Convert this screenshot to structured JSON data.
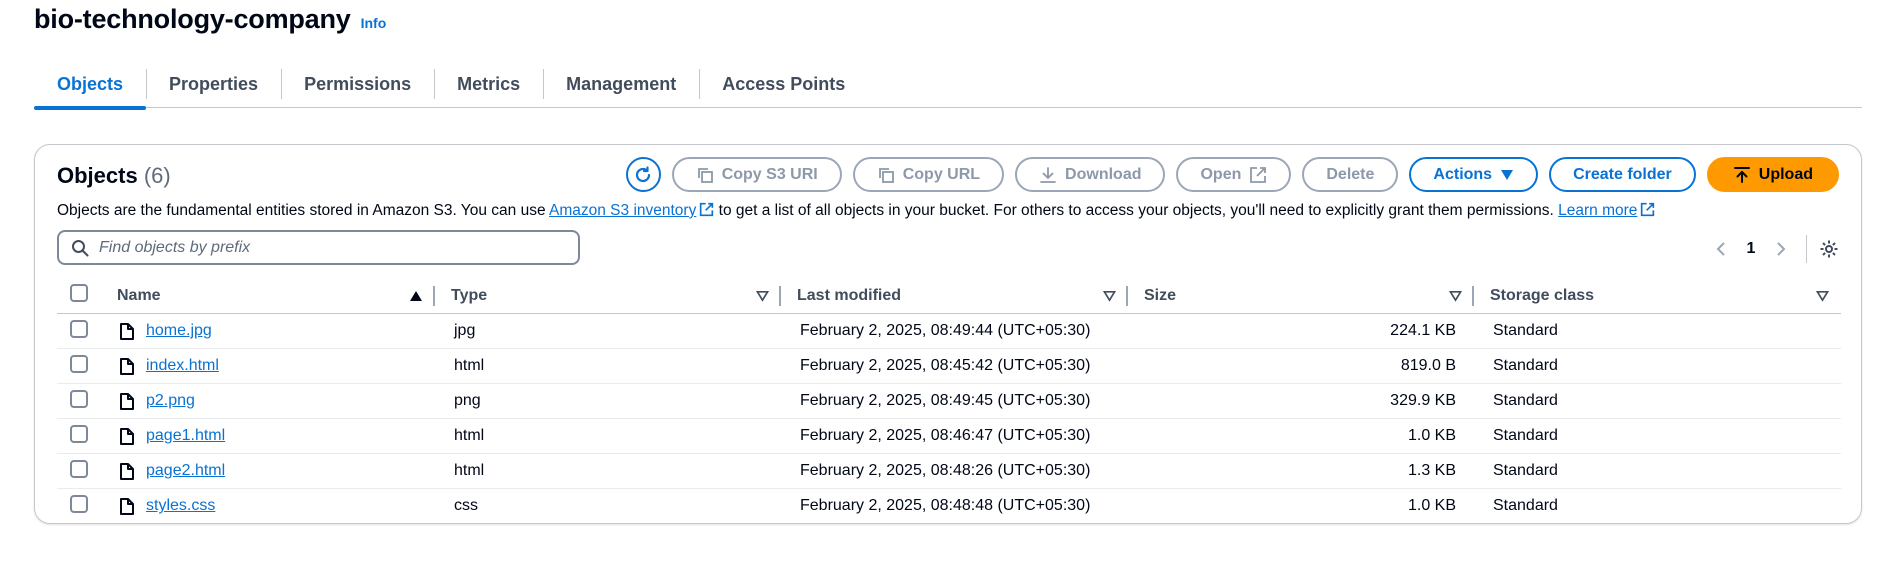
{
  "header": {
    "title": "bio-technology-company",
    "info": "Info"
  },
  "tabs": [
    {
      "label": "Objects",
      "active": true
    },
    {
      "label": "Properties"
    },
    {
      "label": "Permissions"
    },
    {
      "label": "Metrics"
    },
    {
      "label": "Management"
    },
    {
      "label": "Access Points"
    }
  ],
  "panel": {
    "title": "Objects",
    "count": "(6)",
    "description": {
      "before": "Objects are the fundamental entities stored in Amazon S3. You can use ",
      "inventory_link": "Amazon S3 inventory",
      "middle": " to get a list of all objects in your bucket. For others to access your objects, you'll need to explicitly grant them permissions. ",
      "learn_more": "Learn more"
    },
    "toolbar": {
      "copy_s3_uri": "Copy S3 URI",
      "copy_url": "Copy URL",
      "download": "Download",
      "open": "Open",
      "delete": "Delete",
      "actions": "Actions",
      "create_folder": "Create folder",
      "upload": "Upload"
    },
    "search": {
      "placeholder": "Find objects by prefix",
      "value": ""
    },
    "pagination": {
      "page": "1"
    }
  },
  "table": {
    "columns": [
      "Name",
      "Type",
      "Last modified",
      "Size",
      "Storage class"
    ],
    "rows": [
      {
        "name": "home.jpg",
        "type": "jpg",
        "modified": "February 2, 2025, 08:49:44 (UTC+05:30)",
        "size": "224.1 KB",
        "storage": "Standard"
      },
      {
        "name": "index.html",
        "type": "html",
        "modified": "February 2, 2025, 08:45:42 (UTC+05:30)",
        "size": "819.0 B",
        "storage": "Standard"
      },
      {
        "name": "p2.png",
        "type": "png",
        "modified": "February 2, 2025, 08:49:45 (UTC+05:30)",
        "size": "329.9 KB",
        "storage": "Standard"
      },
      {
        "name": "page1.html",
        "type": "html",
        "modified": "February 2, 2025, 08:46:47 (UTC+05:30)",
        "size": "1.0 KB",
        "storage": "Standard"
      },
      {
        "name": "page2.html",
        "type": "html",
        "modified": "February 2, 2025, 08:48:26 (UTC+05:30)",
        "size": "1.3 KB",
        "storage": "Standard"
      },
      {
        "name": "styles.css",
        "type": "css",
        "modified": "February 2, 2025, 08:48:48 (UTC+05:30)",
        "size": "1.0 KB",
        "storage": "Standard"
      }
    ]
  },
  "colors": {
    "link": "#0972d3",
    "primary": "#ff9900",
    "text": "#000716",
    "border": "#c6c6cd"
  }
}
